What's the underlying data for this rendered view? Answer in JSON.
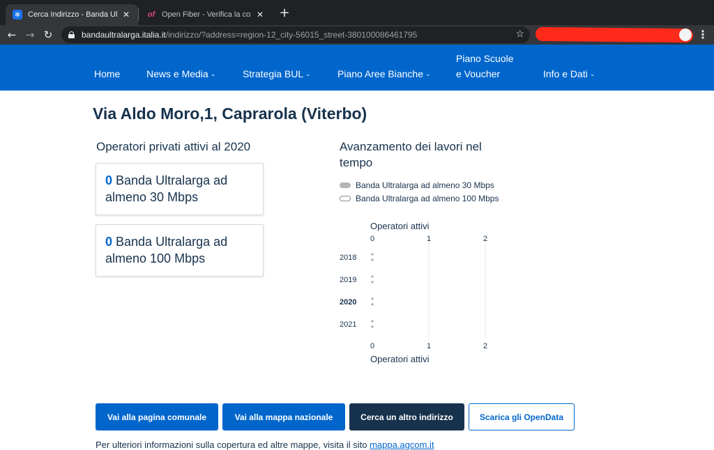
{
  "browser": {
    "tabs": [
      {
        "title": "Cerca Indirizzo - Banda Ultra Larga",
        "active": true,
        "icon": "bul-snowflake-icon"
      },
      {
        "title": "Open Fiber - Verifica la copertura",
        "active": false,
        "icon": "open-fiber-icon",
        "fav_text": "of"
      }
    ],
    "tab_close": "✕",
    "new_tab": "+",
    "url_host": "bandaultralarga.italia.it",
    "url_path": "/indirizzo/?address=region-12_city-56015_street-380100086461795",
    "back": "←",
    "forward": "→",
    "reload": "↻",
    "bookmark": "☆",
    "menu": "⋮"
  },
  "nav": {
    "home": "Home",
    "news": "News e Media",
    "strategia": "Strategia BUL",
    "piano": "Piano Aree Bianche",
    "scuole_line1": "Piano Scuole",
    "scuole_line2": "e Voucher",
    "info": "Info e Dati",
    "chevron": "⌄"
  },
  "page": {
    "title": "Via Aldo Moro,1, Caprarola (Viterbo)"
  },
  "operatori": {
    "title": "Operatori privati attivi al 2020",
    "cards": [
      {
        "count": "0",
        "label": "Banda Ultralarga ad almeno 30 Mbps"
      },
      {
        "count": "0",
        "label": "Banda Ultralarga ad almeno 100 Mbps"
      }
    ]
  },
  "avanzamento": {
    "title": "Avanzamento dei lavori nel tempo",
    "legend": [
      {
        "label": "Banda Ultralarga ad almeno 30 Mbps",
        "style": "filled"
      },
      {
        "label": "Banda Ultralarga ad almeno 100 Mbps",
        "style": "outline"
      }
    ]
  },
  "chart_data": {
    "type": "scatter",
    "title": "",
    "xlabel": "Operatori attivi",
    "x_ticks": [
      "0",
      "1",
      "2"
    ],
    "xlim": [
      0,
      2
    ],
    "categories": [
      "2018",
      "2019",
      "2020",
      "2021"
    ],
    "highlight_category": "2020",
    "series": [
      {
        "name": "Banda Ultralarga ad almeno 30 Mbps",
        "values": [
          0,
          0,
          0,
          0
        ]
      },
      {
        "name": "Banda Ultralarga ad almeno 100 Mbps",
        "values": [
          0,
          0,
          0,
          0
        ]
      }
    ],
    "grid": true,
    "colors": {
      "point": "#a7aaad",
      "grid": "#e3e4e6"
    }
  },
  "actions": {
    "comunale": "Vai alla pagina comunale",
    "mappa": "Vai alla mappa nazionale",
    "cerca": "Cerca un altro indirizzo",
    "opendata": "Scarica gli OpenData"
  },
  "footer": {
    "text": "Per ulteriori informazioni sulla copertura ed altre mappe, visita il sito ",
    "link": "mappa.agcom.it"
  },
  "colors": {
    "brand_blue": "#0066cc",
    "dark_navy": "#17324d",
    "redaction": "#ff2a1a"
  }
}
